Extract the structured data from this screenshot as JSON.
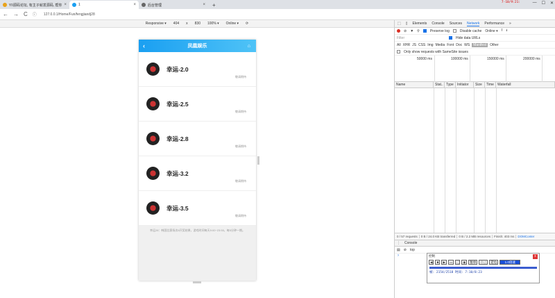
{
  "browser": {
    "tabs": [
      {
        "title": "YII源码论坛, 有主子就发源码, 帮你..",
        "fav_color": "#e8a21a"
      },
      {
        "title": "1",
        "fav_color": "#1a9ff1"
      },
      {
        "title": "后台管理",
        "fav_color": "#666666"
      }
    ],
    "newtab": "+",
    "url": "127.0.0.1/Home/Fun/fengjiandj28",
    "nav": {
      "back": "←",
      "forward": "→",
      "reload": "C"
    },
    "window_controls": [
      "—",
      "☐",
      "✕"
    ],
    "watermark": "7-10/9:21:"
  },
  "device_toolbar": {
    "device": "Responsive ▾",
    "width": "404",
    "times": "x",
    "height": "830",
    "zoom": "100% ▾",
    "network": "Online ▾"
  },
  "app": {
    "title": "凤凰娱乐",
    "items": [
      {
        "name": "幸运-2.0",
        "note": "敬请期待"
      },
      {
        "name": "幸运-2.5",
        "note": "敬请期待"
      },
      {
        "name": "幸运-2.8",
        "note": "敬请期待"
      },
      {
        "name": "幸运-3.2",
        "note": "敬请期待"
      },
      {
        "name": "幸运-3.5",
        "note": "敬请期待"
      }
    ],
    "footer": "幸运28：韩国比赛场次8开奖结果，游戏时间每天9:00~23:55，每5分钟一期。"
  },
  "devtools": {
    "tabs": [
      "Elements",
      "Console",
      "Sources",
      "Network",
      "Performance",
      "»"
    ],
    "active_tab": "Network",
    "toolbar": {
      "preserve_log": "Preserve log",
      "disable_cache": "Disable cache",
      "online": "Online ▾"
    },
    "filter": "Filter",
    "hide_data_urls": "Hide data URLs",
    "types": [
      "All",
      "XHR",
      "JS",
      "CSS",
      "Img",
      "Media",
      "Font",
      "Doc",
      "WS",
      "Manifest",
      "Other"
    ],
    "active_type": "Manifest",
    "blocked": "Only show requests with SameSite issues",
    "timeline": [
      "50000 ms",
      "100000 ms",
      "150000 ms",
      "200000 ms"
    ],
    "columns": [
      "Name",
      "Stat..",
      "Type",
      "Initiator",
      "Size",
      "Time",
      "Waterfall"
    ],
    "status": [
      "0 / 57 requests",
      "0 B / 24.0 KB transferred",
      "0 B / 2.2 MB resources",
      "Finish: 403 ms",
      "DOMConter"
    ],
    "drawer": {
      "tab": "Console",
      "context": "top"
    }
  },
  "recorder": {
    "title": "控制",
    "buttons": [
      "暂停",
      "停止",
      "定位"
    ],
    "speed": "1.0倍速",
    "info": "帧: 2154/2518 时间: 7:10/8:23"
  }
}
